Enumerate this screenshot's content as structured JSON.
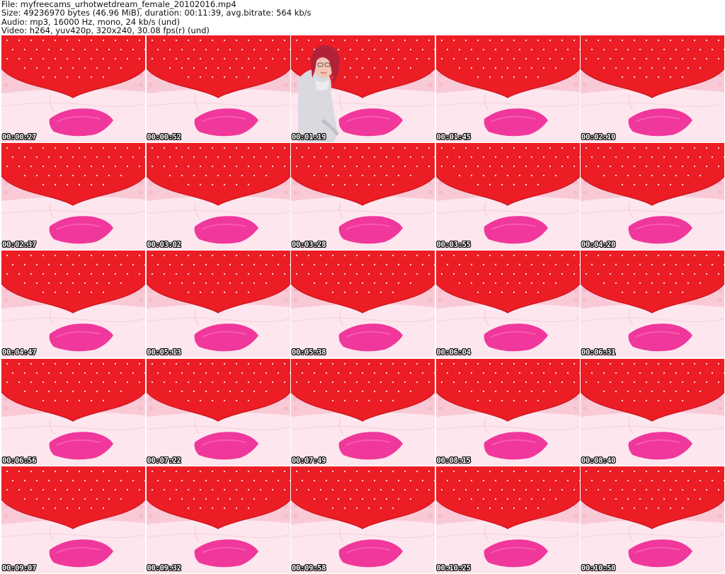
{
  "header": {
    "file": "File: myfreecams_urhotwetdream_female_20102016.mp4",
    "size": "Size: 49236970 bytes (46.96 MiB), duration: 00:11:39, avg.bitrate: 564 kb/s",
    "audio": "Audio: mp3, 16000 Hz, mono, 24 kb/s (und)",
    "video": "Video: h264, yuv420p, 320x240, 30.08 fps(r) (und)"
  },
  "colors": {
    "headboard": "#ec1d24",
    "wall": "#f9c9d6",
    "sheet": "#fde6ee",
    "pillow": "#f0379b"
  },
  "thumbnails": [
    {
      "time": "00:00:27",
      "person": false
    },
    {
      "time": "00:00:52",
      "person": false
    },
    {
      "time": "00:01:19",
      "person": true
    },
    {
      "time": "00:01:45",
      "person": false
    },
    {
      "time": "00:02:10",
      "person": false
    },
    {
      "time": "00:02:37",
      "person": false
    },
    {
      "time": "00:03:02",
      "person": false
    },
    {
      "time": "00:03:28",
      "person": false
    },
    {
      "time": "00:03:55",
      "person": false
    },
    {
      "time": "00:04:20",
      "person": false
    },
    {
      "time": "00:04:47",
      "person": false
    },
    {
      "time": "00:05:13",
      "person": false
    },
    {
      "time": "00:05:38",
      "person": false
    },
    {
      "time": "00:06:04",
      "person": false
    },
    {
      "time": "00:06:31",
      "person": false
    },
    {
      "time": "00:06:56",
      "person": false
    },
    {
      "time": "00:07:22",
      "person": false
    },
    {
      "time": "00:07:49",
      "person": false
    },
    {
      "time": "00:08:15",
      "person": false
    },
    {
      "time": "00:08:40",
      "person": false
    },
    {
      "time": "00:09:07",
      "person": false
    },
    {
      "time": "00:09:32",
      "person": false
    },
    {
      "time": "00:09:58",
      "person": false
    },
    {
      "time": "00:10:25",
      "person": false
    },
    {
      "time": "00:10:50",
      "person": false
    }
  ]
}
